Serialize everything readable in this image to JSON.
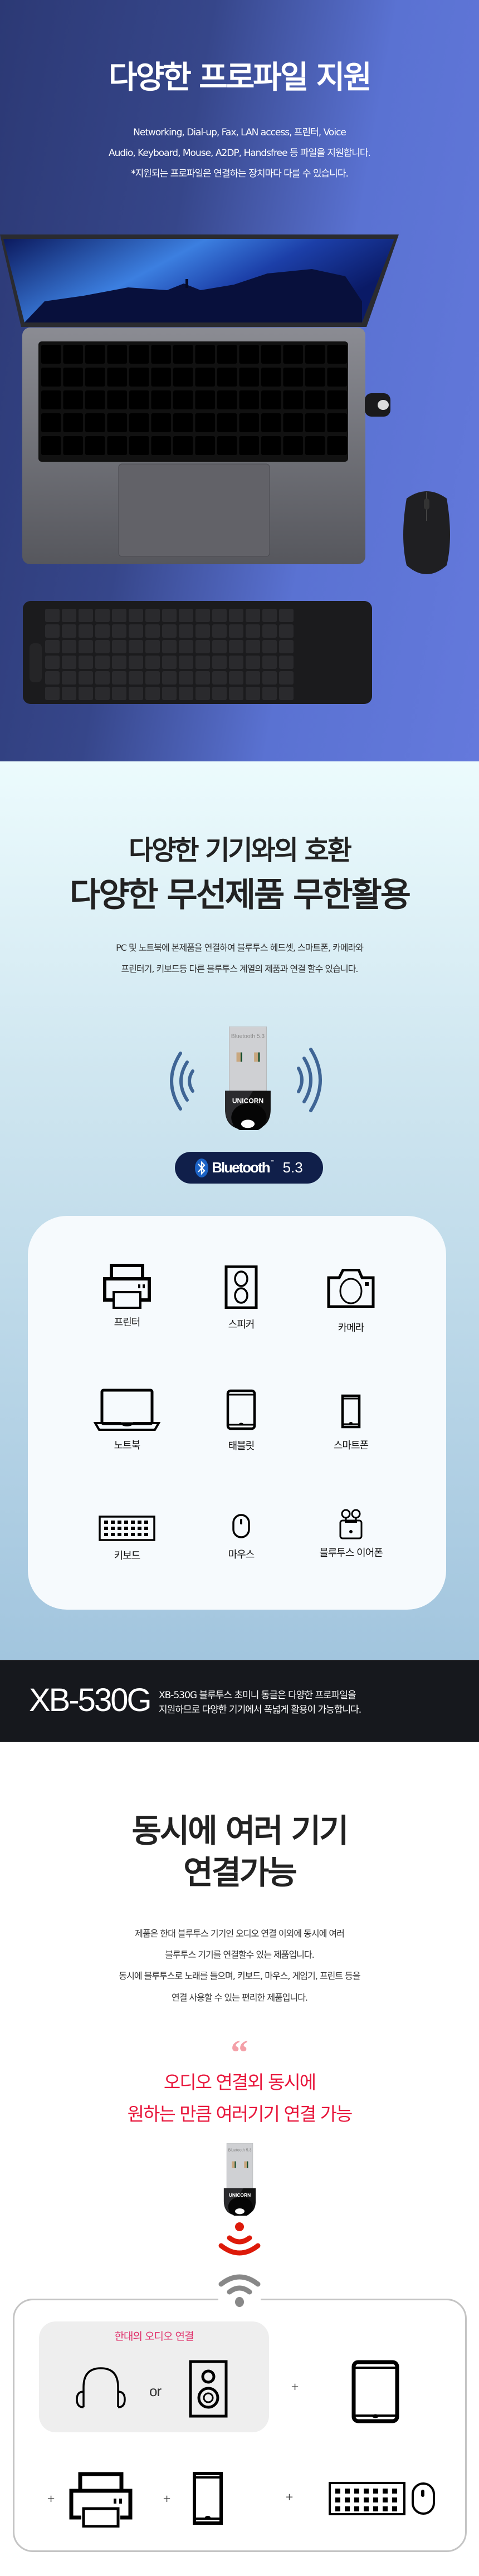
{
  "section1": {
    "title": "다양한 프로파일 지원",
    "lines": [
      "Networking, Dial-up, Fax, LAN access, 프린터, Voice",
      "Audio, Keyboard, Mouse, A2DP, Handsfree 등 파일을 지원합니다.",
      "*지원되는 프로파일은 연결하는 장치마다 다를 수 있습니다."
    ],
    "background": [
      "#2c3975",
      "#6479dc"
    ]
  },
  "section2": {
    "title_line1": "다양한 기기와의 호환",
    "title_line2": "다양한 무선제품 무한활용",
    "desc_lines": [
      "PC 및 노트북에 본제품을 연결하여 블루투스 헤드셋, 스마트폰, 카메라와",
      "프린터기, 키보드등 다른 블루투스 계열의 제품과 연결 할수  있습니다."
    ],
    "dongle": {
      "brand": "UNICORN",
      "plug_label": "Bluetooth 5.3"
    },
    "badge": {
      "name": "Bluetooth",
      "tm": "™",
      "version": "5.3",
      "icon": "bluetooth-icon"
    },
    "devices": [
      {
        "label": "프린터",
        "icon": "printer-icon"
      },
      {
        "label": "스피커",
        "icon": "speaker-icon"
      },
      {
        "label": "카메라",
        "icon": "camera-icon"
      },
      {
        "label": "노트북",
        "icon": "laptop-icon"
      },
      {
        "label": "태블릿",
        "icon": "tablet-icon"
      },
      {
        "label": "스마트폰",
        "icon": "smartphone-icon"
      },
      {
        "label": "키보드",
        "icon": "keyboard-icon"
      },
      {
        "label": "마우스",
        "icon": "mouse-icon"
      },
      {
        "label": "블루투스 이어폰",
        "icon": "earbuds-icon"
      }
    ]
  },
  "banner": {
    "model": "XB-530G",
    "lines": [
      "XB-530G 블루투스 초미니 동글은 다양한 프로파일을",
      "지원하므로 다양한 기기에서 폭넓게 활용이 가능합니다."
    ]
  },
  "section3": {
    "title_lines": [
      "동시에 여러 기기",
      "연결가능"
    ],
    "desc_lines": [
      "제품은 한대 블루투스 기기인 오디오 연결 이외에 동시에 여러",
      "블루투스 기기를 연결할수 있는 제품입니다.",
      "동시에 블루투스로 노래를 들으며, 키보드, 마우스, 게임기, 프린트 등을",
      "연결 사용할 수 있는 편리한 제품입니다."
    ],
    "quote_mark": "“",
    "highlight_lines": [
      "오디오 연결외 동시에",
      "원하는 만큼 여러기기 연결 가능"
    ],
    "audio_box_label": "한대의 오디오 연결",
    "or_label": "or",
    "plus": "+"
  },
  "colors": {
    "accent_red": "#e8173c",
    "accent_pink": "#e0306a",
    "wave_blue": "#3f6595",
    "badge_navy": "#101f4a",
    "banner_dark": "#16181d"
  }
}
